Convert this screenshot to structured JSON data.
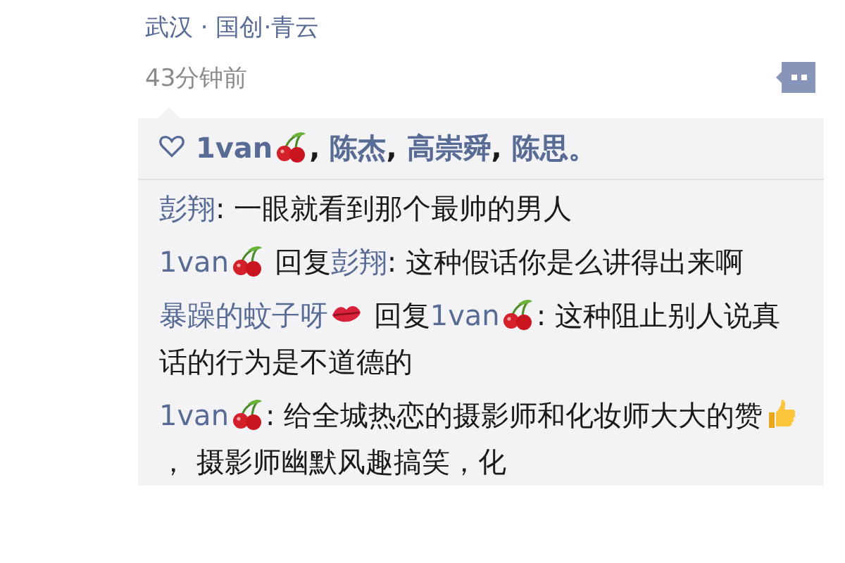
{
  "post": {
    "location": "武汉 · 国创·青云",
    "time": "43分钟前"
  },
  "likes": [
    {
      "kind": "user",
      "text": "1van"
    },
    {
      "kind": "cherry"
    },
    {
      "kind": "text",
      "text": ", "
    },
    {
      "kind": "user",
      "text": "陈杰"
    },
    {
      "kind": "text",
      "text": ", "
    },
    {
      "kind": "user",
      "text": "高崇舜"
    },
    {
      "kind": "text",
      "text": ", "
    },
    {
      "kind": "user",
      "text": "陈思"
    },
    {
      "kind": "user",
      "text": "。"
    }
  ],
  "comments": [
    {
      "segments": [
        {
          "kind": "user",
          "text": "彭翔"
        },
        {
          "kind": "text",
          "text": ": 一眼就看到那个最帅的男人"
        }
      ]
    },
    {
      "segments": [
        {
          "kind": "user",
          "text": "1van"
        },
        {
          "kind": "cherry"
        },
        {
          "kind": "text",
          "text": " 回复"
        },
        {
          "kind": "user",
          "text": "彭翔"
        },
        {
          "kind": "text",
          "text": ": 这种假话你是么讲得出来啊"
        }
      ]
    },
    {
      "segments": [
        {
          "kind": "user",
          "text": "暴躁的蚊子呀"
        },
        {
          "kind": "lips"
        },
        {
          "kind": "text",
          "text": " 回复"
        },
        {
          "kind": "user",
          "text": "1van"
        },
        {
          "kind": "cherry"
        },
        {
          "kind": "text",
          "text": ": 这种阻止别人说真话的行为是不道德的"
        }
      ]
    },
    {
      "segments": [
        {
          "kind": "user",
          "text": "1van"
        },
        {
          "kind": "cherry"
        },
        {
          "kind": "text",
          "text": ": 给全城热恋的摄影师和化妆师大大的赞"
        },
        {
          "kind": "thumbs"
        },
        {
          "kind": "text",
          "text": "，  摄影师幽默风趣搞笑，化"
        }
      ]
    }
  ]
}
